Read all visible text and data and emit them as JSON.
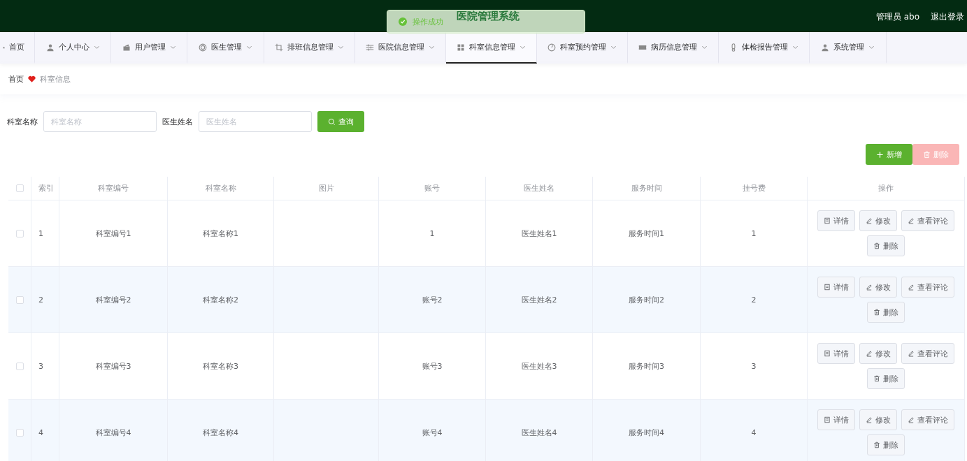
{
  "header": {
    "title": "医院管理系统",
    "user": "管理员 abo",
    "logout": "退出登录"
  },
  "toast": {
    "message": "操作成功"
  },
  "nav": {
    "items": [
      {
        "label": "首页",
        "selected": false,
        "has_menu": false
      },
      {
        "label": "个人中心",
        "selected": false,
        "has_menu": true
      },
      {
        "label": "用户管理",
        "selected": false,
        "has_menu": true
      },
      {
        "label": "医生管理",
        "selected": false,
        "has_menu": true
      },
      {
        "label": "排班信息管理",
        "selected": false,
        "has_menu": true
      },
      {
        "label": "医院信息管理",
        "selected": false,
        "has_menu": true
      },
      {
        "label": "科室信息管理",
        "selected": true,
        "has_menu": true
      },
      {
        "label": "科室预约管理",
        "selected": false,
        "has_menu": true
      },
      {
        "label": "病历信息管理",
        "selected": false,
        "has_menu": true
      },
      {
        "label": "体检报告管理",
        "selected": false,
        "has_menu": true
      },
      {
        "label": "系统管理",
        "selected": false,
        "has_menu": true
      }
    ]
  },
  "breadcrumb": [
    {
      "label": "首页"
    },
    {
      "label": "科室信息"
    }
  ],
  "search": {
    "fields": [
      {
        "label": "科室名称",
        "placeholder": "科室名称"
      },
      {
        "label": "医生姓名",
        "placeholder": "医生姓名"
      }
    ],
    "button": "查询"
  },
  "toolbar": {
    "buttons": [
      {
        "label": "新增",
        "kind": "add",
        "disabled": false
      },
      {
        "label": "删除",
        "kind": "delete",
        "disabled": true
      }
    ]
  },
  "table": {
    "select_all": {
      "checked": false
    },
    "columns": [
      "索引",
      "科室编号",
      "科室名称",
      "图片",
      "账号",
      "医生姓名",
      "服务时间",
      "挂号费",
      "操作"
    ],
    "rows": [
      {
        "checked": false,
        "index": "1",
        "dept_no": "科室编号1",
        "dept_name": "科室名称1",
        "account": "1",
        "doctor": "医生姓名1",
        "service_time": "服务时间1",
        "fee": "1",
        "actions": [
          "详情",
          "修改",
          "查看评论",
          "删除"
        ]
      },
      {
        "checked": false,
        "index": "2",
        "dept_no": "科室编号2",
        "dept_name": "科室名称2",
        "account": "账号2",
        "doctor": "医生姓名2",
        "service_time": "服务时间2",
        "fee": "2",
        "actions": [
          "详情",
          "修改",
          "查看评论",
          "删除"
        ]
      },
      {
        "checked": false,
        "index": "3",
        "dept_no": "科室编号3",
        "dept_name": "科室名称3",
        "account": "账号3",
        "doctor": "医生姓名3",
        "service_time": "服务时间3",
        "fee": "3",
        "actions": [
          "详情",
          "修改",
          "查看评论",
          "删除"
        ]
      },
      {
        "checked": false,
        "index": "4",
        "dept_no": "科室编号4",
        "dept_name": "科室名称4",
        "account": "账号4",
        "doctor": "医生姓名4",
        "service_time": "服务时间4",
        "fee": "4",
        "actions": [
          "详情",
          "修改",
          "查看评论",
          "删除"
        ]
      }
    ]
  }
}
